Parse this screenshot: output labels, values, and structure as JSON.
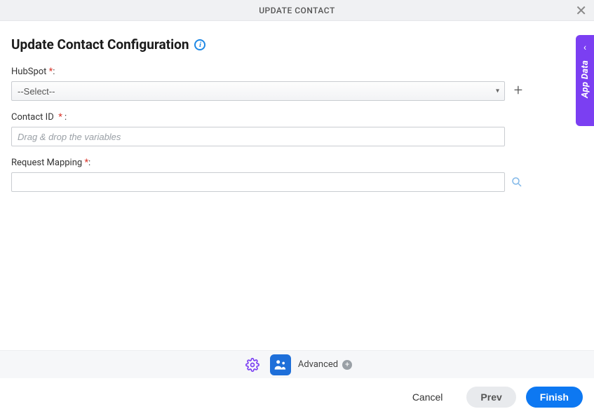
{
  "header": {
    "title": "UPDATE CONTACT"
  },
  "section": {
    "title": "Update Contact Configuration"
  },
  "fields": {
    "hubspot": {
      "label": "HubSpot",
      "selected": "--Select--"
    },
    "contactId": {
      "label": "Contact ID",
      "placeholder": "Drag & drop the variables",
      "value": ""
    },
    "requestMapping": {
      "label": "Request Mapping",
      "value": ""
    }
  },
  "sideTab": {
    "label": "App Data"
  },
  "toolbar": {
    "advanced": "Advanced"
  },
  "footer": {
    "cancel": "Cancel",
    "prev": "Prev",
    "finish": "Finish"
  }
}
